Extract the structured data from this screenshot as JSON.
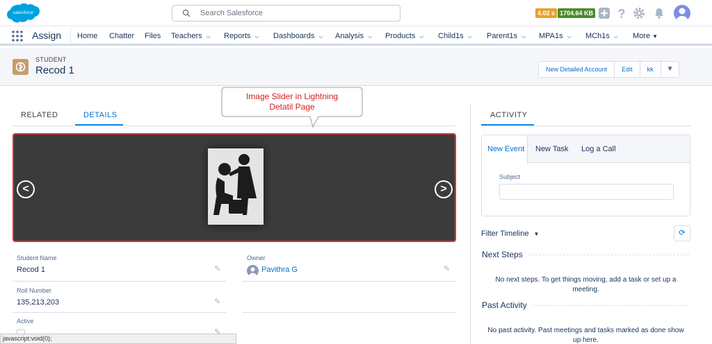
{
  "header": {
    "logo_text": "salesforce",
    "search_placeholder": "Search Salesforce",
    "timing_badge": "4.02 s",
    "size_badge": "1704.64 KB",
    "badge_colors": {
      "timing": "#e9a030",
      "size": "#4a8c2a"
    }
  },
  "nav": {
    "app_name": "Assign",
    "items": [
      {
        "label": "Home",
        "has_menu": false
      },
      {
        "label": "Chatter",
        "has_menu": false
      },
      {
        "label": "Files",
        "has_menu": false
      },
      {
        "label": "Teachers",
        "has_menu": true
      },
      {
        "label": "Reports",
        "has_menu": true
      },
      {
        "label": "Dashboards",
        "has_menu": true
      },
      {
        "label": "Analysis",
        "has_menu": true
      },
      {
        "label": "Products",
        "has_menu": true
      },
      {
        "label": "Child1s",
        "has_menu": true
      },
      {
        "label": "Parent1s",
        "has_menu": true
      },
      {
        "label": "MPA1s",
        "has_menu": true
      },
      {
        "label": "MCh1s",
        "has_menu": true
      },
      {
        "label": "More",
        "has_menu": true
      }
    ]
  },
  "record": {
    "object_type": "STUDENT",
    "name": "Recod 1",
    "actions": [
      "New Detailed Account",
      "Edit",
      "kk"
    ]
  },
  "tabs": {
    "related": "RELATED",
    "details": "DETAILS"
  },
  "callout": {
    "line1": "Image Slider in Lightning",
    "line2": "Detatil Page",
    "color": "#d81b1b"
  },
  "slider": {
    "prev_label": "<",
    "next_label": ">",
    "background": "#3b3b3b",
    "border_color": "#e03131"
  },
  "fields": {
    "student_name_label": "Student Name",
    "student_name_value": "Recod 1",
    "owner_label": "Owner",
    "owner_value": "Pavithra G",
    "roll_number_label": "Roll Number",
    "roll_number_value": "135,213,203",
    "active_label": "Active"
  },
  "status_bar": "javascript:void(0);",
  "activity": {
    "tab": "ACTIVITY",
    "composer_tabs": [
      "New Event",
      "New Task",
      "Log a Call"
    ],
    "subject_label": "Subject",
    "filter_label": "Filter Timeline",
    "next_steps_title": "Next Steps",
    "next_steps_msg": "No next steps. To get things moving, add a task or set up a meeting.",
    "past_title": "Past Activity",
    "past_msg": "No past activity. Past meetings and tasks marked as done show up here."
  }
}
